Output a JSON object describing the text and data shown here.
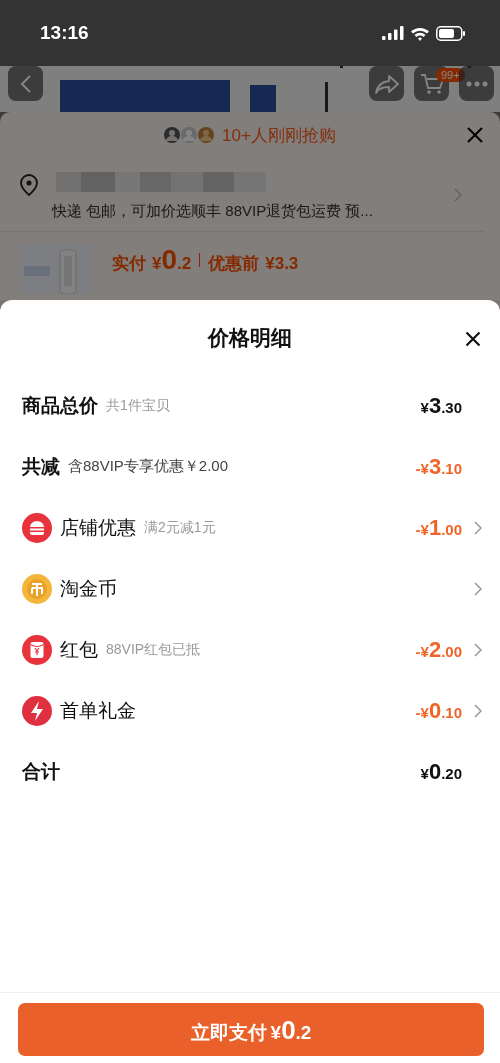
{
  "status_bar": {
    "time": "13:16"
  },
  "background": {
    "cart_badge": "99+",
    "banner": {
      "text": "10+人刚刚抢购"
    },
    "address": {
      "shipping": "快递 包邮，可加价选顺丰 88VIP退货包运费 预..."
    },
    "product": {
      "paid_label": "实付",
      "paid_price": "¥0.2",
      "original_label": "优惠前",
      "original_price": "¥3.3"
    }
  },
  "sheet": {
    "title": "价格明细",
    "rows": [
      {
        "kind": "plain",
        "label": "商品总价",
        "note": "共1件宝贝",
        "amount": "¥3.30",
        "discount": false,
        "arrow": false
      },
      {
        "kind": "plain",
        "label": "共减",
        "note": "含88VIP专享优惠￥2.00",
        "amount": "-¥3.10",
        "discount": true,
        "arrow": false
      },
      {
        "kind": "shop",
        "label": "店铺优惠",
        "note": "满2元减1元",
        "amount": "-¥1.00",
        "discount": true,
        "arrow": true
      },
      {
        "kind": "coin",
        "label": "淘金币",
        "arrow": true
      },
      {
        "kind": "packet",
        "label": "红包",
        "note": "88VIP红包已抵",
        "amount": "-¥2.00",
        "discount": true,
        "arrow": true
      },
      {
        "kind": "bolt",
        "label": "首单礼金",
        "amount": "-¥0.10",
        "discount": true,
        "arrow": true
      },
      {
        "kind": "plain",
        "label": "合计",
        "amount": "¥0.20",
        "discount": false,
        "arrow": false
      }
    ],
    "pay_button": {
      "label": "立即支付",
      "price": "¥0.2"
    }
  }
}
